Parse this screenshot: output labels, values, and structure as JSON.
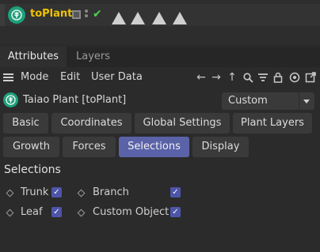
{
  "object_manager": {
    "object_name": "toPlant",
    "tag_icons": [
      "triangle-icon",
      "triangle-icon",
      "triangle-icon",
      "triangle-icon"
    ]
  },
  "tabs": [
    {
      "label": "Attributes",
      "active": true
    },
    {
      "label": "Layers",
      "active": false
    }
  ],
  "menu": {
    "items": [
      "Mode",
      "Edit",
      "User Data"
    ],
    "toolbar_icons": [
      "back-arrow-icon",
      "forward-arrow-icon",
      "up-arrow-icon",
      "search-icon",
      "filter-icon",
      "lock-icon",
      "target-icon",
      "open-window-icon"
    ]
  },
  "object_header": {
    "title": "Taiao Plant [toPlant]",
    "mode_value": "Custom"
  },
  "categories": {
    "row1": [
      "Basic",
      "Coordinates",
      "Global Settings",
      "Plant Layers"
    ],
    "row2": [
      "Growth",
      "Forces",
      "Selections",
      "Display"
    ],
    "active": "Selections"
  },
  "selections": {
    "title": "Selections",
    "params": [
      {
        "label": "Trunk",
        "checked": true
      },
      {
        "label": "Branch",
        "checked": true
      },
      {
        "label": "Leaf",
        "checked": true
      },
      {
        "label": "Custom Object",
        "checked": true
      }
    ]
  },
  "colors": {
    "accent_active": "#5a62a8",
    "object_name": "#f0c200",
    "plant_icon": "#1ea07a",
    "check_green": "#4fd44f"
  }
}
